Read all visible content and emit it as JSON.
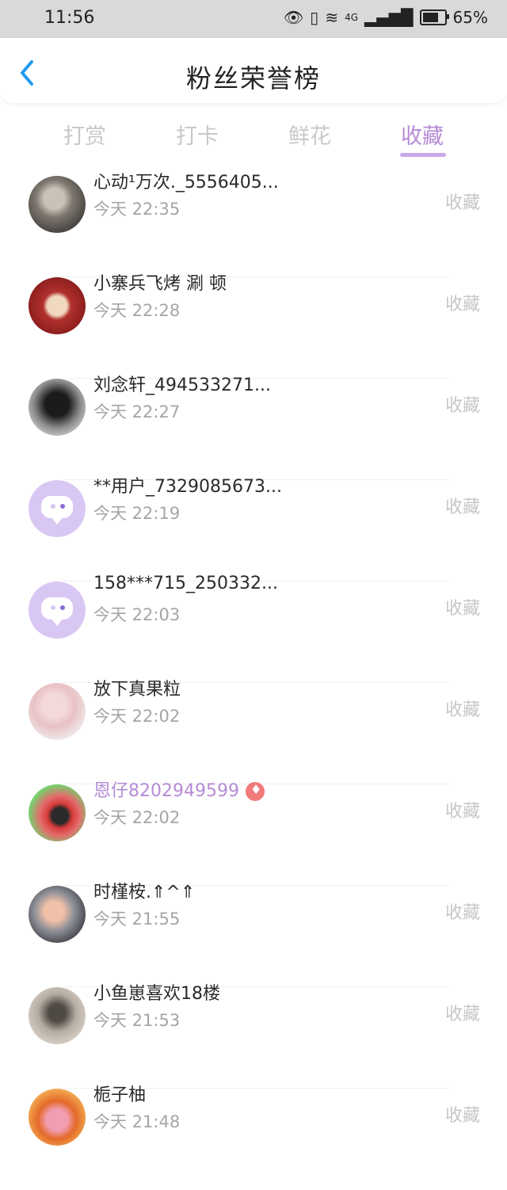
{
  "status_bar": {
    "time": "11:56",
    "battery_percent_text": "65%",
    "battery_level": 0.65,
    "signal_text": "4G"
  },
  "header": {
    "title": "粉丝荣誉榜"
  },
  "tabs": [
    {
      "label": "打赏"
    },
    {
      "label": "打卡"
    },
    {
      "label": "鲜花"
    },
    {
      "label": "收藏"
    }
  ],
  "active_tab": "收藏",
  "list": [
    {
      "name": "心动¹万次._5556405...",
      "time": "今天 22:35",
      "action": "收藏"
    },
    {
      "name": "小寨兵飞烤 涮 顿",
      "time": "今天 22:28",
      "action": "收藏"
    },
    {
      "name": "刘念轩_494533271...",
      "time": "今天 22:27",
      "action": "收藏"
    },
    {
      "name": "**用户_7329085673...",
      "time": "今天 22:19",
      "action": "收藏"
    },
    {
      "name": "158***715_250332...",
      "time": "今天 22:03",
      "action": "收藏"
    },
    {
      "name": "放下真果粒",
      "time": "今天 22:02",
      "action": "收藏"
    },
    {
      "name": "恩仔8202949599",
      "time": "今天 22:02",
      "action": "收藏"
    },
    {
      "name": "时槿桉.⇑^⇑",
      "time": "今天 21:55",
      "action": "收藏"
    },
    {
      "name": "小鱼崽喜欢18楼",
      "time": "今天 21:53",
      "action": "收藏"
    },
    {
      "name": "栀子柚",
      "time": "今天 21:48",
      "action": "收藏"
    }
  ],
  "colors": {
    "accent_purple": "#b58bd6",
    "underline_purple": "#c9a8e8",
    "avatar_lavender": "#d9c7f3",
    "vip_badge_red": "#f07a7a"
  }
}
